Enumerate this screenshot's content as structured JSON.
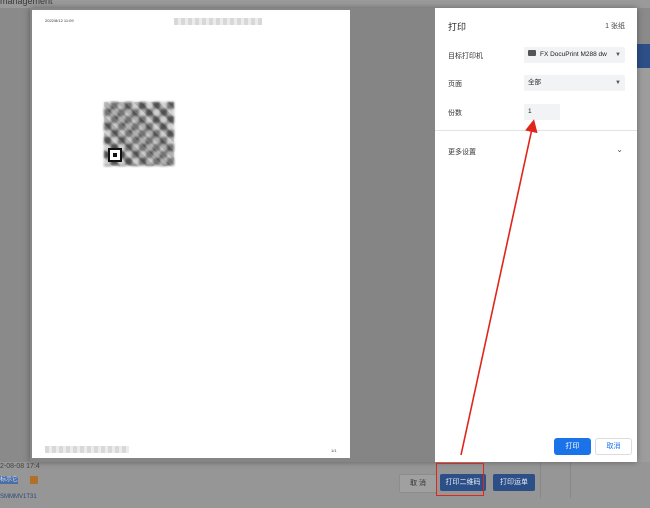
{
  "background_app": {
    "title_fragment": "management",
    "date_fragment": "2-08-08 17:4",
    "chip_label": "标示它",
    "link_fragment": "SMMMV1T31",
    "cancel_label": "取 消",
    "print_qr_label": "打印二维码",
    "print_shipment_label": "打印运单"
  },
  "dialog": {
    "title": "打印",
    "sheet_count": "1 张纸",
    "destination_label": "目标打印机",
    "destination_value": "FX DocuPrint M288 dw",
    "pages_label": "页面",
    "pages_value": "全部",
    "copies_label": "份数",
    "copies_value": "1",
    "more_settings_label": "更多设置",
    "print_button": "打印",
    "cancel_button": "取消"
  },
  "preview": {
    "date": "2022/8/12 11:09",
    "page_number": "1/1"
  },
  "colors": {
    "accent": "#1a73e8",
    "annotation": "#e0261b",
    "app_button": "#2b4f86"
  }
}
